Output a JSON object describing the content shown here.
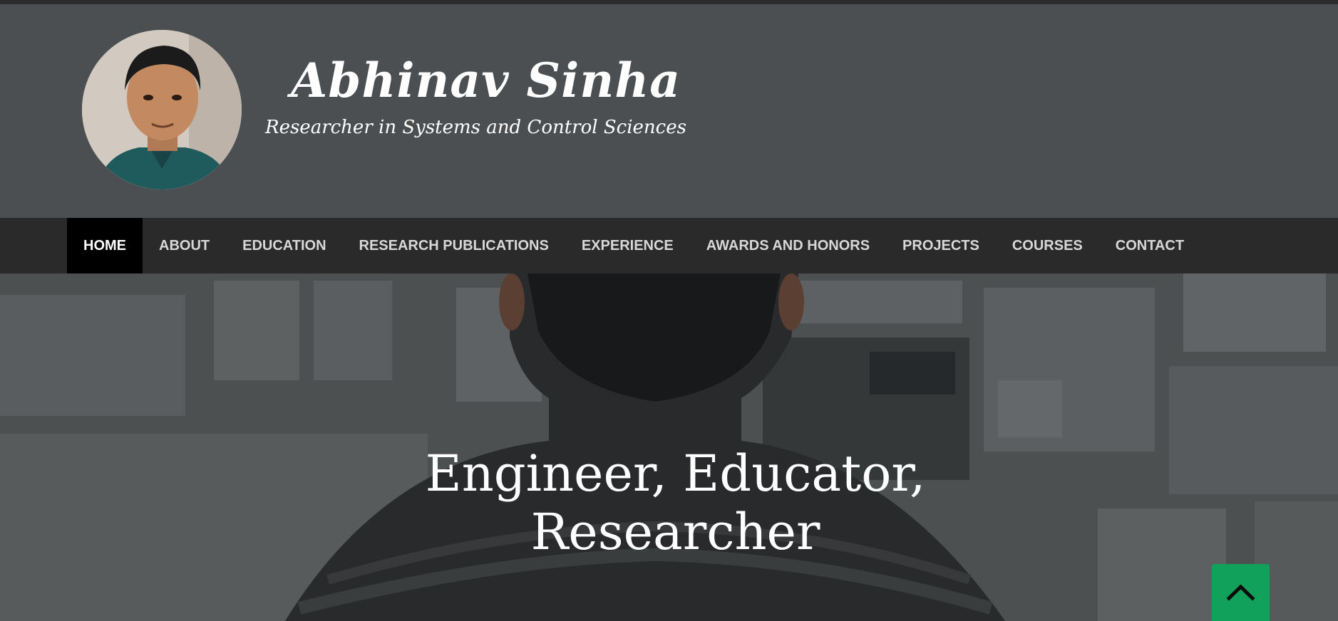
{
  "header": {
    "title": "Abhinav Sinha",
    "tagline": "Researcher in Systems and Control Sciences",
    "avatar_icon": "profile-photo"
  },
  "nav": {
    "items": [
      {
        "label": "HOME",
        "active": true
      },
      {
        "label": "ABOUT"
      },
      {
        "label": "EDUCATION"
      },
      {
        "label": "RESEARCH PUBLICATIONS"
      },
      {
        "label": "EXPERIENCE"
      },
      {
        "label": "AWARDS AND HONORS"
      },
      {
        "label": "PROJECTS"
      },
      {
        "label": "COURSES"
      },
      {
        "label": "CONTACT"
      }
    ]
  },
  "hero": {
    "headline_line1": "Engineer, Educator,",
    "headline_line2": "Researcher"
  },
  "scroll_top": {
    "icon": "chevron-up-icon"
  },
  "colors": {
    "header_bg": "#4b4f51",
    "nav_bg": "#2a2a2a",
    "nav_active_bg": "#000000",
    "accent_green": "#11a15a"
  }
}
